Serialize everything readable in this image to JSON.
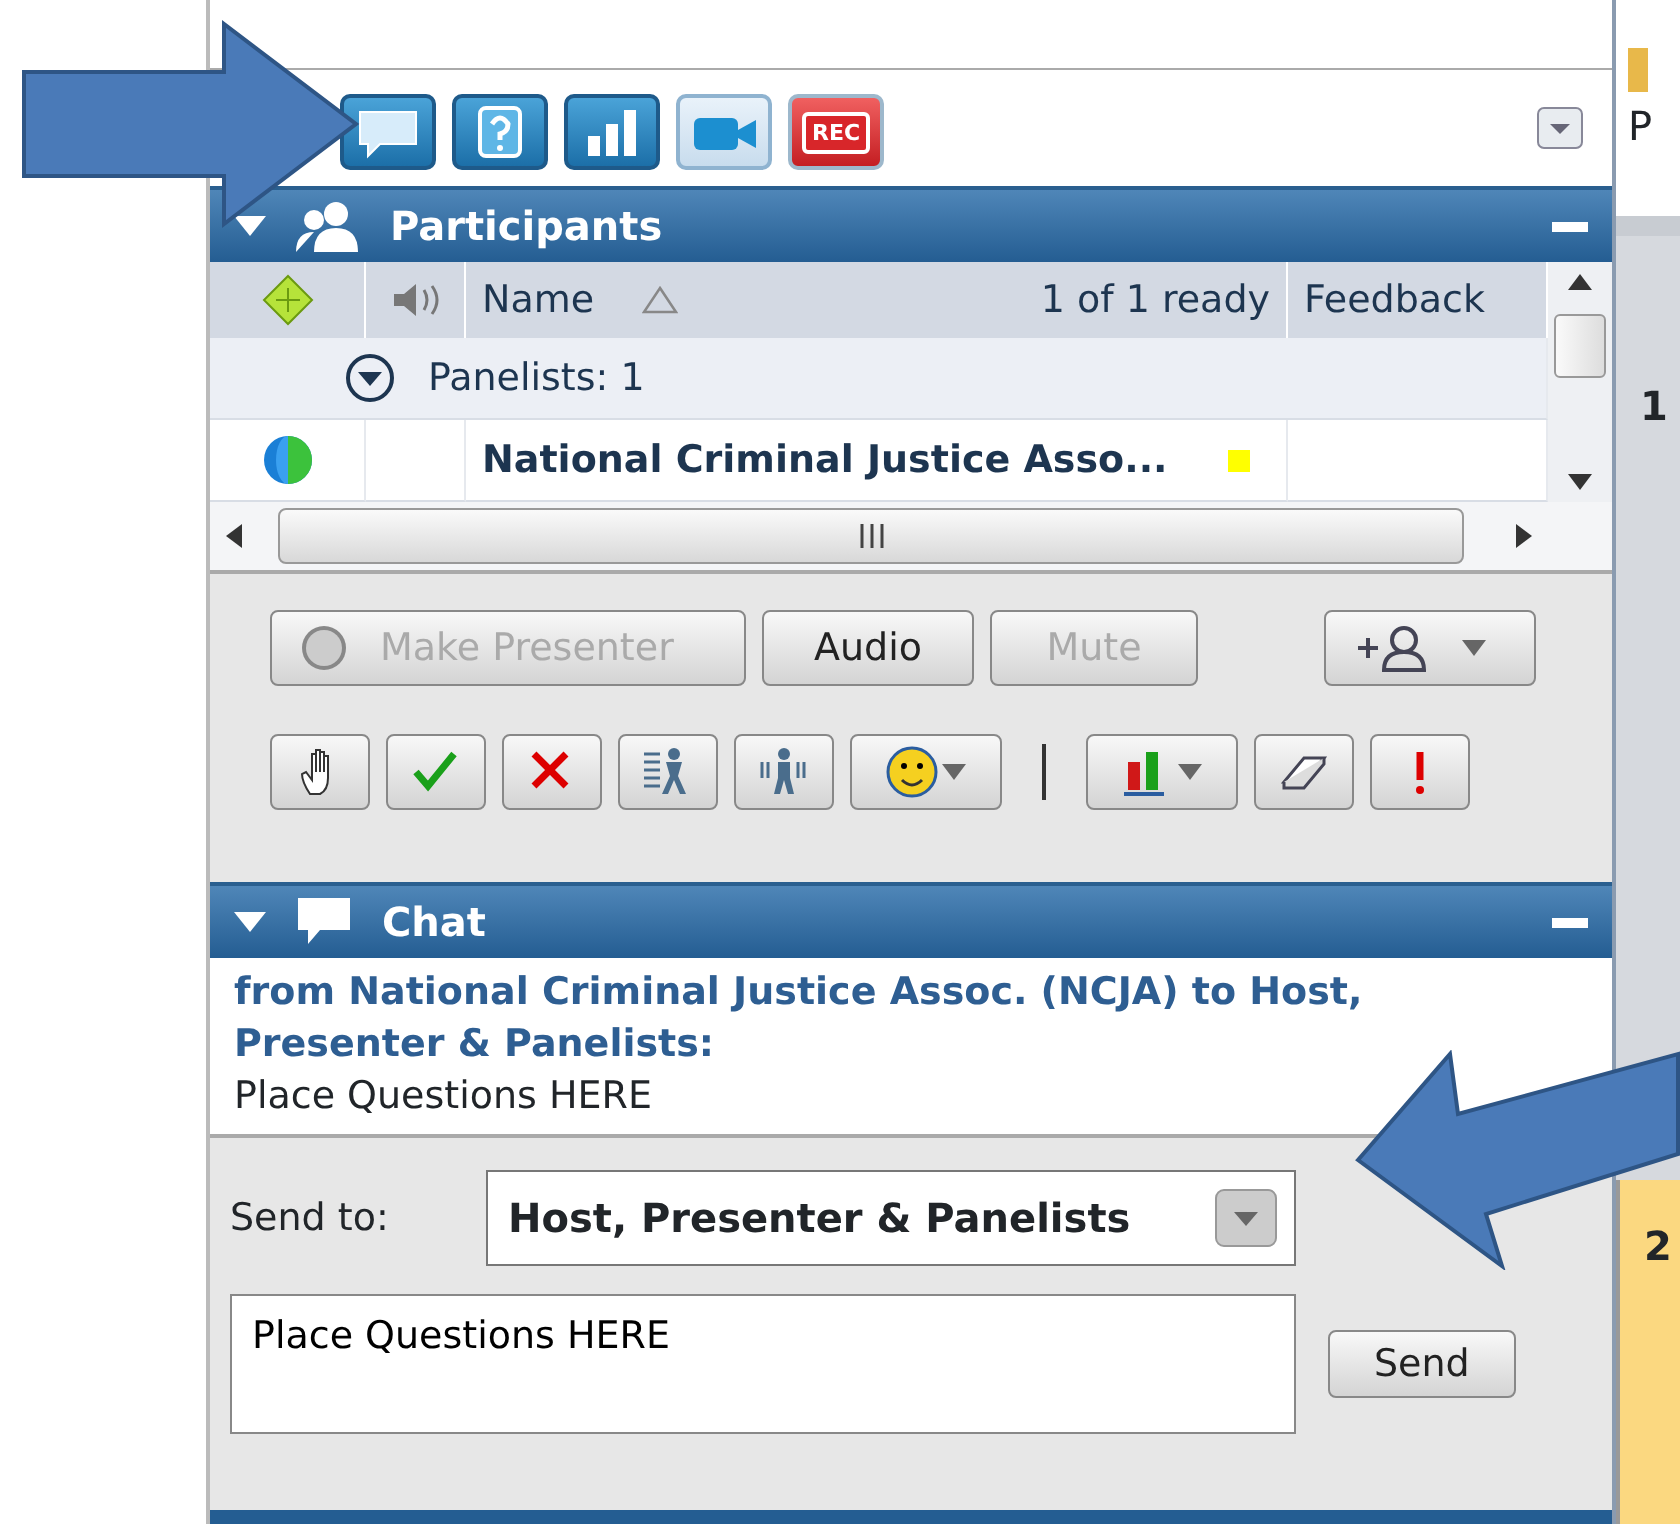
{
  "toolbar": {
    "buttons": [
      {
        "kind": "chat"
      },
      {
        "kind": "help"
      },
      {
        "kind": "poll"
      },
      {
        "kind": "video"
      },
      {
        "kind": "record",
        "label": "REC"
      }
    ]
  },
  "participants": {
    "title": "Participants",
    "columns": [
      "Name",
      "1 of 1 ready",
      "Feedback"
    ],
    "group": {
      "label": "Panelists: 1",
      "expanded": true
    },
    "rows": [
      {
        "name": "National Criminal Justice Asso...",
        "color": "#ffff00"
      }
    ],
    "actions": [
      {
        "label": "Make Presenter",
        "disabled": true
      },
      {
        "label": "Audio",
        "disabled": false
      },
      {
        "label": "Mute",
        "disabled": true
      }
    ],
    "tools": [
      {
        "kind": "hand"
      },
      {
        "kind": "check"
      },
      {
        "kind": "cross"
      },
      {
        "kind": "faster"
      },
      {
        "kind": "slower"
      },
      {
        "kind": "emoticon"
      },
      {
        "kind": "separator"
      },
      {
        "kind": "chart"
      },
      {
        "kind": "eraser"
      },
      {
        "kind": "alert"
      }
    ]
  },
  "chat": {
    "title": "Chat",
    "message": {
      "header": "from National Criminal Justice Assoc. (NCJA) to Host, Presenter & Panelists:",
      "text": "Place Questions HERE"
    },
    "send_to_label": "Send to:",
    "recipient": "Host, Presenter & Panelists",
    "input": "Place Questions HERE",
    "send": "Send"
  },
  "edge_texts": [
    "P",
    "1",
    "2"
  ],
  "callouts": [
    {
      "kind": "rightward"
    },
    {
      "kind": "leftward"
    }
  ]
}
